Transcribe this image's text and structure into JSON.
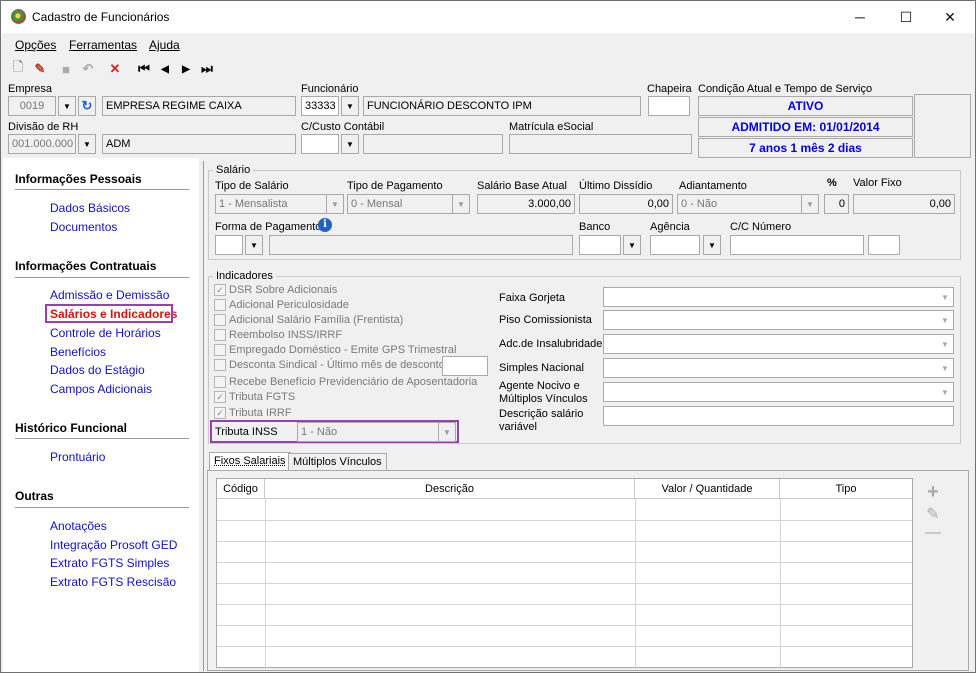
{
  "window": {
    "title": "Cadastro de Funcionários",
    "minimize": "─",
    "maximize": "☐",
    "close": "✕"
  },
  "menu": [
    "Opções",
    "Ferramentas",
    "Ajuda"
  ],
  "header": {
    "empresa_label": "Empresa",
    "empresa_code": "0019",
    "empresa_name": "EMPRESA REGIME CAIXA",
    "funcionario_label": "Funcionário",
    "funcionario_code": "33333",
    "funcionario_name": "FUNCIONÁRIO DESCONTO IPM",
    "chapeira_label": "Chapeira",
    "chapeira_value": "",
    "condicao_label": "Condição Atual e Tempo de Serviço",
    "status": "ATIVO",
    "admitido": "ADMITIDO EM: 01/01/2014",
    "tempo": "7 anos 1 mês 2 dias",
    "divisao_label": "Divisão de RH",
    "divisao_code": "001.000.000",
    "divisao_name": "ADM",
    "ccusto_label": "C/Custo Contábil",
    "ccusto_code": "",
    "ccusto_name": "",
    "matricula_label": "Matrícula eSocial",
    "matricula_value": ""
  },
  "nav": {
    "sections": [
      {
        "title": "Informações Pessoais",
        "items": [
          "Dados Básicos",
          "Documentos"
        ]
      },
      {
        "title": "Informações Contratuais",
        "items": [
          "Admissão e Demissão",
          "Salários e Indicadores",
          "Controle de Horários",
          "Benefícios",
          "Dados do Estágio",
          "Campos Adicionais"
        ]
      },
      {
        "title": "Histórico Funcional",
        "items": [
          "Prontuário"
        ]
      },
      {
        "title": "Outras",
        "items": [
          "Anotações",
          "Integração Prosoft GED",
          "Extrato FGTS Simples",
          "Extrato FGTS Rescisão"
        ]
      }
    ],
    "selected": "Salários e Indicadores"
  },
  "salario": {
    "group": "Salário",
    "tipo_label": "Tipo de Salário",
    "tipo_value": "1 - Mensalista",
    "pagto_label": "Tipo de Pagamento",
    "pagto_value": "0 - Mensal",
    "base_label": "Salário Base Atual",
    "base_value": "3.000,00",
    "dissidio_label": "Último Dissídio",
    "dissidio_value": "0,00",
    "adiant_label": "Adiantamento",
    "adiant_value": "0 - Não",
    "pct_label": "%",
    "pct_value": "0",
    "fixo_label": "Valor Fixo",
    "fixo_value": "0,00",
    "forma_label": "Forma de Pagamento",
    "banco_label": "Banco",
    "agencia_label": "Agência",
    "cc_label": "C/C Número"
  },
  "indicadores": {
    "group": "Indicadores",
    "checks": [
      {
        "label": "DSR Sobre Adicionais",
        "checked": true
      },
      {
        "label": "Adicional Periculosidade",
        "checked": false
      },
      {
        "label": "Adicional Salário Família (Frentista)",
        "checked": false
      },
      {
        "label": "Reembolso INSS/IRRF",
        "checked": false
      },
      {
        "label": "Empregado Doméstico - Emite GPS Trimestral",
        "checked": false
      },
      {
        "label": "Desconta Sindical - Último mês de desconto",
        "checked": false
      },
      {
        "label": "Recebe Benefício Previdenciário de Aposentadoria",
        "checked": false
      },
      {
        "label": "Tributa FGTS",
        "checked": true
      },
      {
        "label": "Tributa IRRF",
        "checked": true
      }
    ],
    "inss_label": "Tributa INSS",
    "inss_value": "1 - Não",
    "right": [
      "Faixa Gorjeta",
      "Piso Comissionista",
      "Adc.de Insalubridade",
      "Simples Nacional",
      "Agente Nocivo e Múltiplos Vínculos",
      "Descrição salário variável"
    ]
  },
  "tabs": [
    "Fixos Salariais",
    "Múltiplos Vínculos"
  ],
  "grid": {
    "columns": [
      "Código",
      "Descrição",
      "Valor / Quantidade",
      "Tipo"
    ]
  },
  "side_buttons": {
    "add": "+",
    "edit": "✎",
    "remove": "—"
  },
  "toolbar": {
    "new": "🗋",
    "edit": "✎",
    "save": "■",
    "undo": "↶",
    "delete": "✕",
    "first": "⏮",
    "prev": "◀",
    "next": "▶",
    "last": "⏭"
  }
}
